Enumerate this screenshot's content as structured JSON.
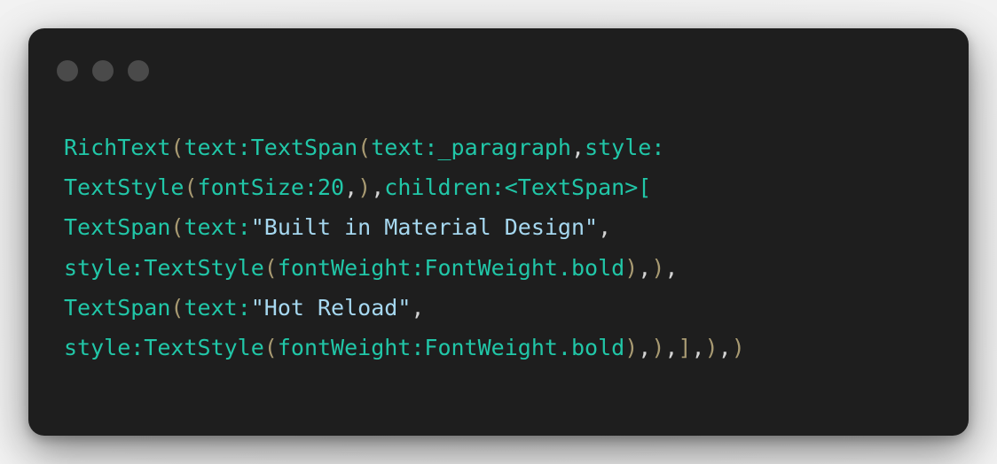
{
  "window": {
    "controls": [
      "close",
      "minimize",
      "zoom"
    ]
  },
  "colors": {
    "background": "#1e1e1e",
    "identifier": "#21c7a8",
    "string": "#a6d8f0",
    "paren": "#a89a72",
    "punctuation": "#d4d4d4",
    "dot": "#4a4a4a"
  },
  "code": {
    "lines": [
      [
        {
          "t": "RichText",
          "k": "ident"
        },
        {
          "t": "(",
          "k": "paren"
        },
        {
          "t": "text:TextSpan",
          "k": "ident"
        },
        {
          "t": "(",
          "k": "paren"
        },
        {
          "t": "text:_paragraph",
          "k": "ident"
        },
        {
          "t": ",",
          "k": "punct"
        },
        {
          "t": "style:",
          "k": "ident"
        }
      ],
      [
        {
          "t": "TextStyle",
          "k": "ident"
        },
        {
          "t": "(",
          "k": "paren"
        },
        {
          "t": "fontSize:20",
          "k": "ident"
        },
        {
          "t": ",",
          "k": "punct"
        },
        {
          "t": ")",
          "k": "paren"
        },
        {
          "t": ",",
          "k": "punct"
        },
        {
          "t": "children:<TextSpan>[",
          "k": "ident"
        }
      ],
      [
        {
          "t": "TextSpan",
          "k": "ident"
        },
        {
          "t": "(",
          "k": "paren"
        },
        {
          "t": "text:",
          "k": "ident"
        },
        {
          "t": "\"Built in Material Design\"",
          "k": "str"
        },
        {
          "t": ",",
          "k": "punct"
        }
      ],
      [
        {
          "t": "style:TextStyle",
          "k": "ident"
        },
        {
          "t": "(",
          "k": "paren"
        },
        {
          "t": "fontWeight:FontWeight.bold",
          "k": "ident"
        },
        {
          "t": ")",
          "k": "paren"
        },
        {
          "t": ",",
          "k": "punct"
        },
        {
          "t": ")",
          "k": "paren"
        },
        {
          "t": ",",
          "k": "punct"
        }
      ],
      [
        {
          "t": "TextSpan",
          "k": "ident"
        },
        {
          "t": "(",
          "k": "paren"
        },
        {
          "t": "text:",
          "k": "ident"
        },
        {
          "t": "\"Hot Reload\"",
          "k": "str"
        },
        {
          "t": ",",
          "k": "punct"
        }
      ],
      [
        {
          "t": "style:TextStyle",
          "k": "ident"
        },
        {
          "t": "(",
          "k": "paren"
        },
        {
          "t": "fontWeight:FontWeight.bold",
          "k": "ident"
        },
        {
          "t": ")",
          "k": "paren"
        },
        {
          "t": ",",
          "k": "punct"
        },
        {
          "t": ")",
          "k": "paren"
        },
        {
          "t": ",",
          "k": "punct"
        },
        {
          "t": "]",
          "k": "paren"
        },
        {
          "t": ",",
          "k": "punct"
        },
        {
          "t": ")",
          "k": "paren"
        },
        {
          "t": ",",
          "k": "punct"
        },
        {
          "t": ")",
          "k": "paren"
        }
      ]
    ]
  }
}
